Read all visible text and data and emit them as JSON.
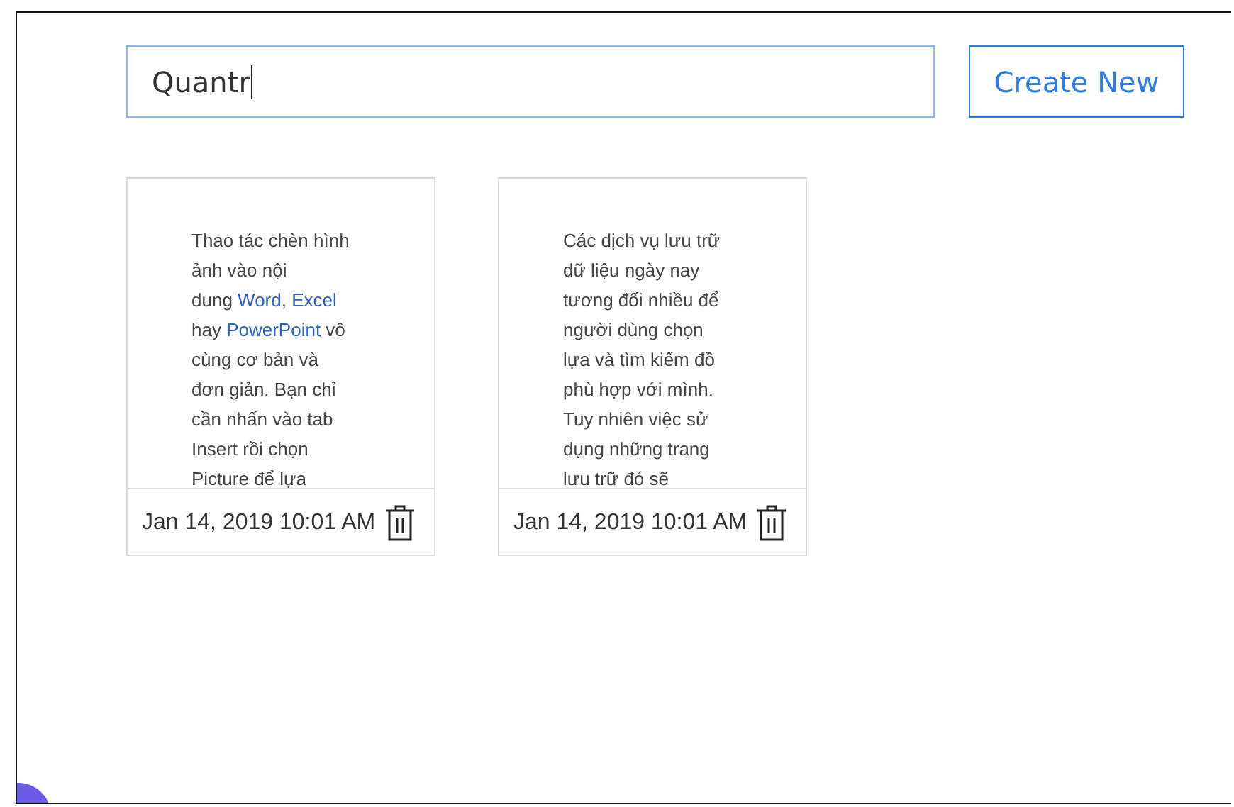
{
  "search": {
    "value": "Quantr"
  },
  "create_button": {
    "label": "Create New"
  },
  "notes": [
    {
      "snippet": [
        {
          "text": "Thao tác chèn hình\nảnh vào nội\ndung ",
          "link": false
        },
        {
          "text": "Word",
          "link": true
        },
        {
          "text": ", ",
          "link": false
        },
        {
          "text": "Excel",
          "link": true
        },
        {
          "text": "\nhay ",
          "link": false
        },
        {
          "text": "PowerPoint",
          "link": true
        },
        {
          "text": " vô\ncùng cơ bản và\nđơn giản. Bạn chỉ\ncần nhấn vào tab\nInsert rồi chọn\nPicture để lựa",
          "link": false
        }
      ],
      "date": "Jan 14, 2019 10:01 AM"
    },
    {
      "snippet": [
        {
          "text": "Các dịch vụ lưu trữ\ndữ liệu ngày nay\ntương đối nhiều để\nngười dùng chọn\nlựa và tìm kiếm đồ\nphù hợp với mình.\nTuy nhiên việc sử\ndụng những trang\nlưu trữ đó sẽ",
          "link": false
        }
      ],
      "date": "Jan 14, 2019 10:01 AM"
    }
  ]
}
